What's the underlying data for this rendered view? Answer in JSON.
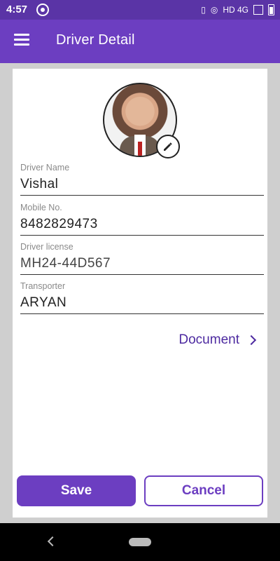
{
  "status_bar": {
    "time": "4:57",
    "network": "HD 4G"
  },
  "app_bar": {
    "title": "Driver Detail"
  },
  "form": {
    "driver_name": {
      "label": "Driver Name",
      "value": "Vishal"
    },
    "mobile": {
      "label": "Mobile No.",
      "value": "8482829473"
    },
    "license": {
      "label": "Driver license",
      "value": "MH24-44D567"
    },
    "transporter": {
      "label": "Transporter",
      "value": "ARYAN"
    }
  },
  "document_link": {
    "label": "Document"
  },
  "actions": {
    "save_label": "Save",
    "cancel_label": "Cancel"
  },
  "colors": {
    "primary": "#6c3ec1",
    "status_bar": "#5a34a6"
  },
  "icons": [
    "menu-icon",
    "edit-icon",
    "chevron-right-icon",
    "back-icon",
    "home-icon"
  ]
}
